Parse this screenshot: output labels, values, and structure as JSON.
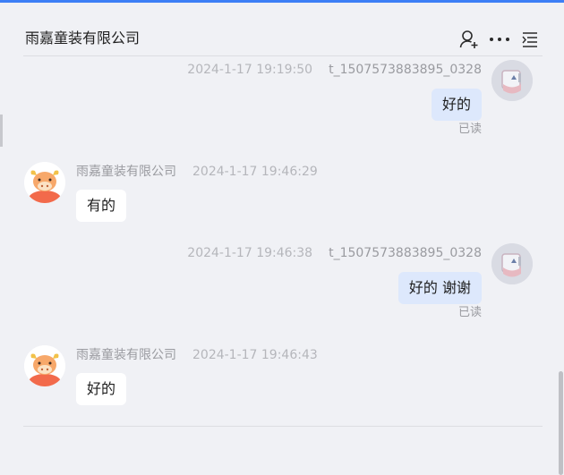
{
  "header": {
    "title": "雨嘉童装有限公司",
    "icons": [
      "add-contact-icon",
      "more-icon",
      "menu-list-icon"
    ]
  },
  "messages": [
    {
      "side": "self",
      "sender": "t_1507573883895_0328",
      "time": "2024-1-17 19:19:50",
      "text": "好的",
      "status": "已读"
    },
    {
      "side": "shop",
      "sender": "雨嘉童装有限公司",
      "time": "2024-1-17 19:46:29",
      "text": "有的"
    },
    {
      "side": "self",
      "sender": "t_1507573883895_0328",
      "time": "2024-1-17 19:46:38",
      "text": "好的 谢谢",
      "status": "已读"
    },
    {
      "side": "shop",
      "sender": "雨嘉童装有限公司",
      "time": "2024-1-17 19:46:43",
      "text": "好的"
    }
  ],
  "colors": {
    "accent": "#3d7ff6",
    "background": "#f0f1f5",
    "self_bubble": "#dde8fc",
    "shop_bubble": "#ffffff"
  }
}
